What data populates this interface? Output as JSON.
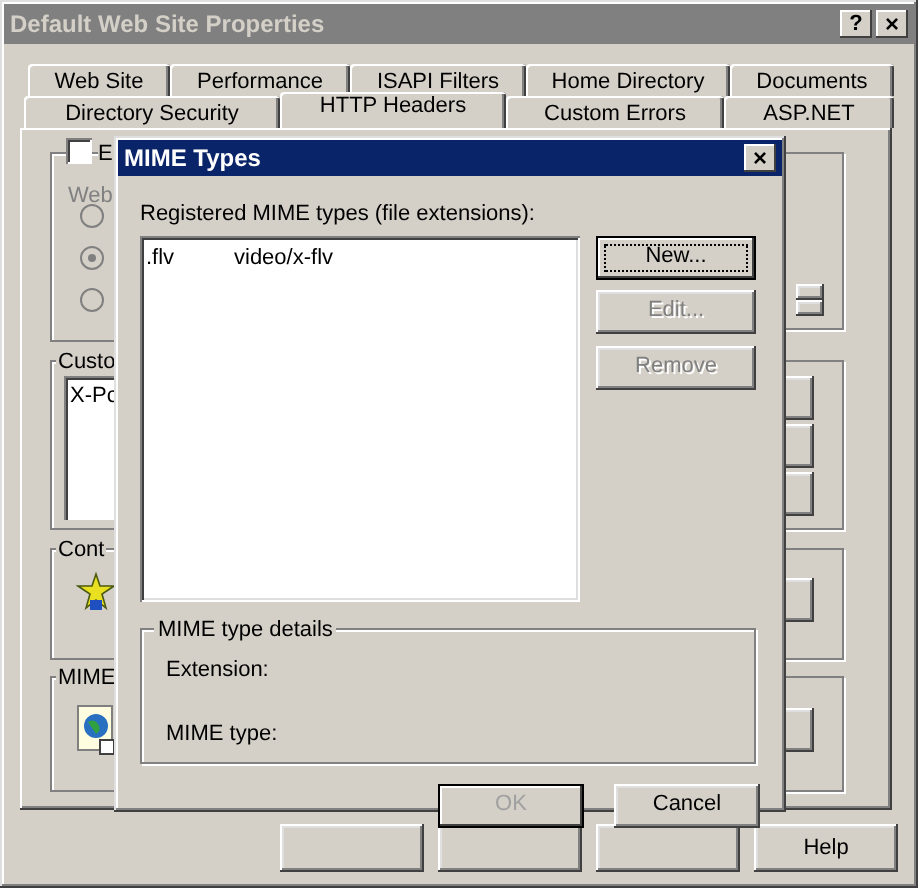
{
  "window": {
    "title": "Default Web Site Properties",
    "help_button": "?",
    "close_button": "×"
  },
  "tab_rows": [
    {
      "tabs": [
        {
          "label": "Web Site",
          "selected": false
        },
        {
          "label": "Performance",
          "selected": false
        },
        {
          "label": "ISAPI Filters",
          "selected": false
        },
        {
          "label": "Home Directory",
          "selected": false
        },
        {
          "label": "Documents",
          "selected": false
        }
      ]
    },
    {
      "tabs": [
        {
          "label": "Directory Security",
          "selected": false
        },
        {
          "label": "HTTP Headers",
          "selected": true
        },
        {
          "label": "Custom Errors",
          "selected": false
        },
        {
          "label": "ASP.NET",
          "selected": false
        }
      ]
    }
  ],
  "panel": {
    "enable_checkbox": {
      "label": "E",
      "checked": false
    },
    "web_label": "Web",
    "radios": [
      {
        "selected": false,
        "disabled": true
      },
      {
        "selected": true,
        "disabled": true
      },
      {
        "selected": false,
        "disabled": true
      }
    ],
    "custom_group": {
      "label": "Custo",
      "items": [
        "X-Pc"
      ]
    },
    "content_group": {
      "label": "Cont"
    },
    "mime_group": {
      "label": "MIME"
    }
  },
  "bottom_buttons": [
    {
      "label": "Help"
    }
  ],
  "mime_dialog": {
    "title": "MIME Types",
    "close_button": "×",
    "list_label": "Registered MIME types (file extensions):",
    "rows": [
      {
        "extension": ".flv",
        "mime_type": "video/x-flv"
      }
    ],
    "side_buttons": [
      {
        "label": "New...",
        "disabled": false,
        "focused": true
      },
      {
        "label": "Edit...",
        "disabled": true,
        "focused": false
      },
      {
        "label": "Remove",
        "disabled": true,
        "focused": false
      }
    ],
    "details": {
      "title": "MIME type details",
      "fields": [
        "Extension:",
        "MIME type:"
      ]
    },
    "buttons": [
      {
        "label": "OK",
        "disabled": true
      },
      {
        "label": "Cancel",
        "disabled": false
      }
    ]
  }
}
